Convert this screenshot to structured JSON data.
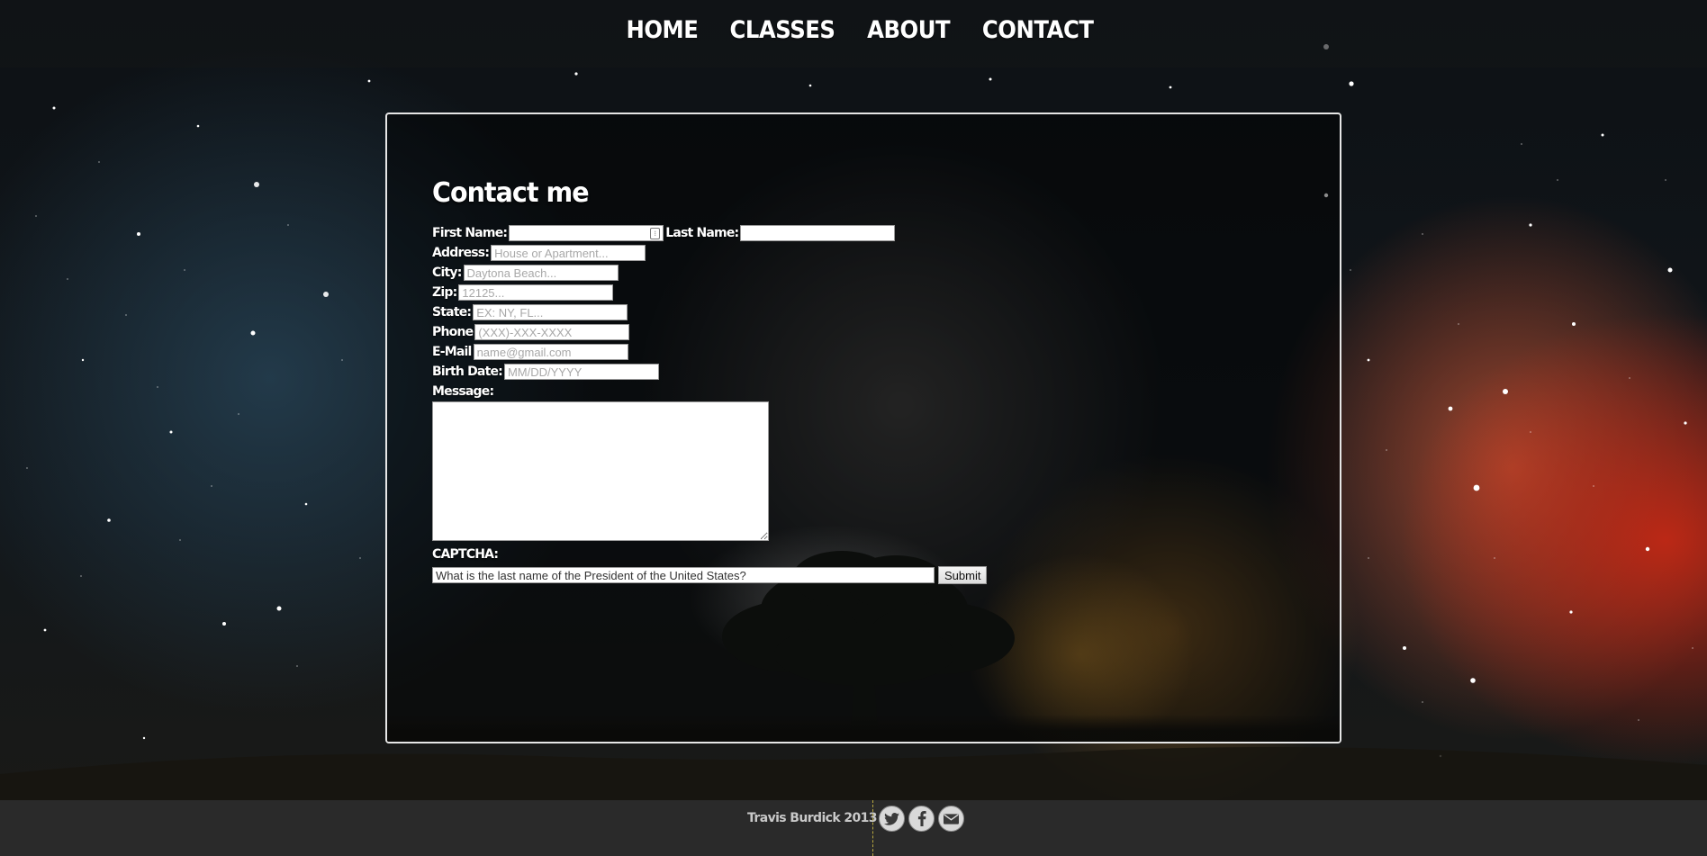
{
  "nav": {
    "items": [
      {
        "label": "HOME"
      },
      {
        "label": "CLASSES"
      },
      {
        "label": "ABOUT"
      },
      {
        "label": "CONTACT"
      }
    ]
  },
  "contact": {
    "title": "Contact me",
    "first_name_label": "First Name:",
    "first_name_value": "",
    "last_name_label": "Last Name:",
    "last_name_value": "",
    "address_label": "Address:",
    "address_placeholder": "House or Apartment...",
    "city_label": "City:",
    "city_placeholder": "Daytona Beach...",
    "zip_label": "Zip:",
    "zip_placeholder": "12125...",
    "state_label": "State:",
    "state_placeholder": "EX: NY, FL...",
    "phone_label": "Phone",
    "phone_placeholder": "(XXX)-XXX-XXXX",
    "email_label": "E-Mail",
    "email_placeholder": "name@gmail.com",
    "birth_label": "Birth Date:",
    "birth_placeholder": "MM/DD/YYYY",
    "message_label": "Message:",
    "message_value": "",
    "captcha_label": "CAPTCHA:",
    "captcha_value": "What is the last name of the President of the United States?",
    "submit_label": "Submit"
  },
  "footer": {
    "copyright": "Travis Burdick 2013",
    "social_icons": [
      "twitter-icon",
      "facebook-icon",
      "mail-icon"
    ]
  }
}
